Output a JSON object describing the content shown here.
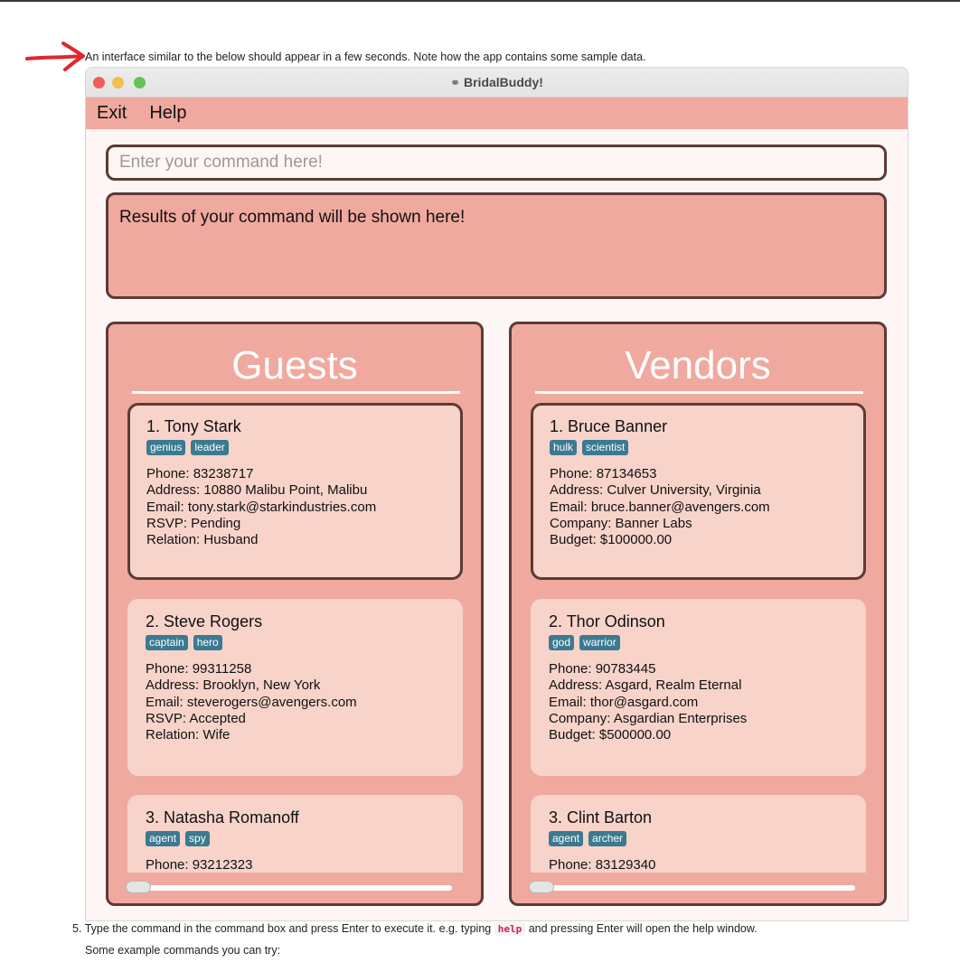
{
  "doc": {
    "intro_text": "An interface similar to the below should appear in a few seconds. Note how the app contains some sample data.",
    "step_number": "5.",
    "step_text_before": "Type the command in the command box and press Enter to execute it. e.g. typing",
    "step_code": "help",
    "step_text_after": "and pressing Enter will open the help window.",
    "step_followup": "Some example commands you can try:",
    "annotation_arrow_color": "#e0262b"
  },
  "window": {
    "title": "BridalBuddy!",
    "app_icon": "wedding-couple-icon"
  },
  "menu": {
    "exit_label": "Exit",
    "help_label": "Help"
  },
  "command": {
    "placeholder": "Enter your command here!"
  },
  "result": {
    "text": "Results of your command will be shown here!"
  },
  "colors": {
    "menu_bg": "#f0a99f",
    "panel_bg": "#f0a99f",
    "card_bg": "#f7d3ca",
    "border": "#5c3b35",
    "tag_bg": "#3b7a91"
  },
  "guests": {
    "title": "Guests",
    "items": [
      {
        "name": "1. Tony Stark",
        "tags": [
          "genius",
          "leader"
        ],
        "phone": "Phone: 83238717",
        "address": "Address: 10880 Malibu Point, Malibu",
        "email": "Email: tony.stark@starkindustries.com",
        "rsvp": "RSVP: Pending",
        "relation": "Relation: Husband"
      },
      {
        "name": "2. Steve Rogers",
        "tags": [
          "captain",
          "hero"
        ],
        "phone": "Phone: 99311258",
        "address": "Address: Brooklyn, New York",
        "email": "Email: steverogers@avengers.com",
        "rsvp": "RSVP: Accepted",
        "relation": "Relation: Wife"
      },
      {
        "name": "3. Natasha Romanoff",
        "tags": [
          "agent",
          "spy"
        ],
        "phone": "Phone: 93212323"
      }
    ]
  },
  "vendors": {
    "title": "Vendors",
    "items": [
      {
        "name": "1. Bruce Banner",
        "tags": [
          "hulk",
          "scientist"
        ],
        "phone": "Phone: 87134653",
        "address": "Address: Culver University, Virginia",
        "email": "Email: bruce.banner@avengers.com",
        "company": "Company: Banner Labs",
        "budget": "Budget: $100000.00"
      },
      {
        "name": "2. Thor Odinson",
        "tags": [
          "god",
          "warrior"
        ],
        "phone": "Phone: 90783445",
        "address": "Address: Asgard, Realm Eternal",
        "email": "Email: thor@asgard.com",
        "company": "Company: Asgardian Enterprises",
        "budget": "Budget: $500000.00"
      },
      {
        "name": "3. Clint Barton",
        "tags": [
          "agent",
          "archer"
        ],
        "phone": "Phone: 83129340"
      }
    ]
  }
}
